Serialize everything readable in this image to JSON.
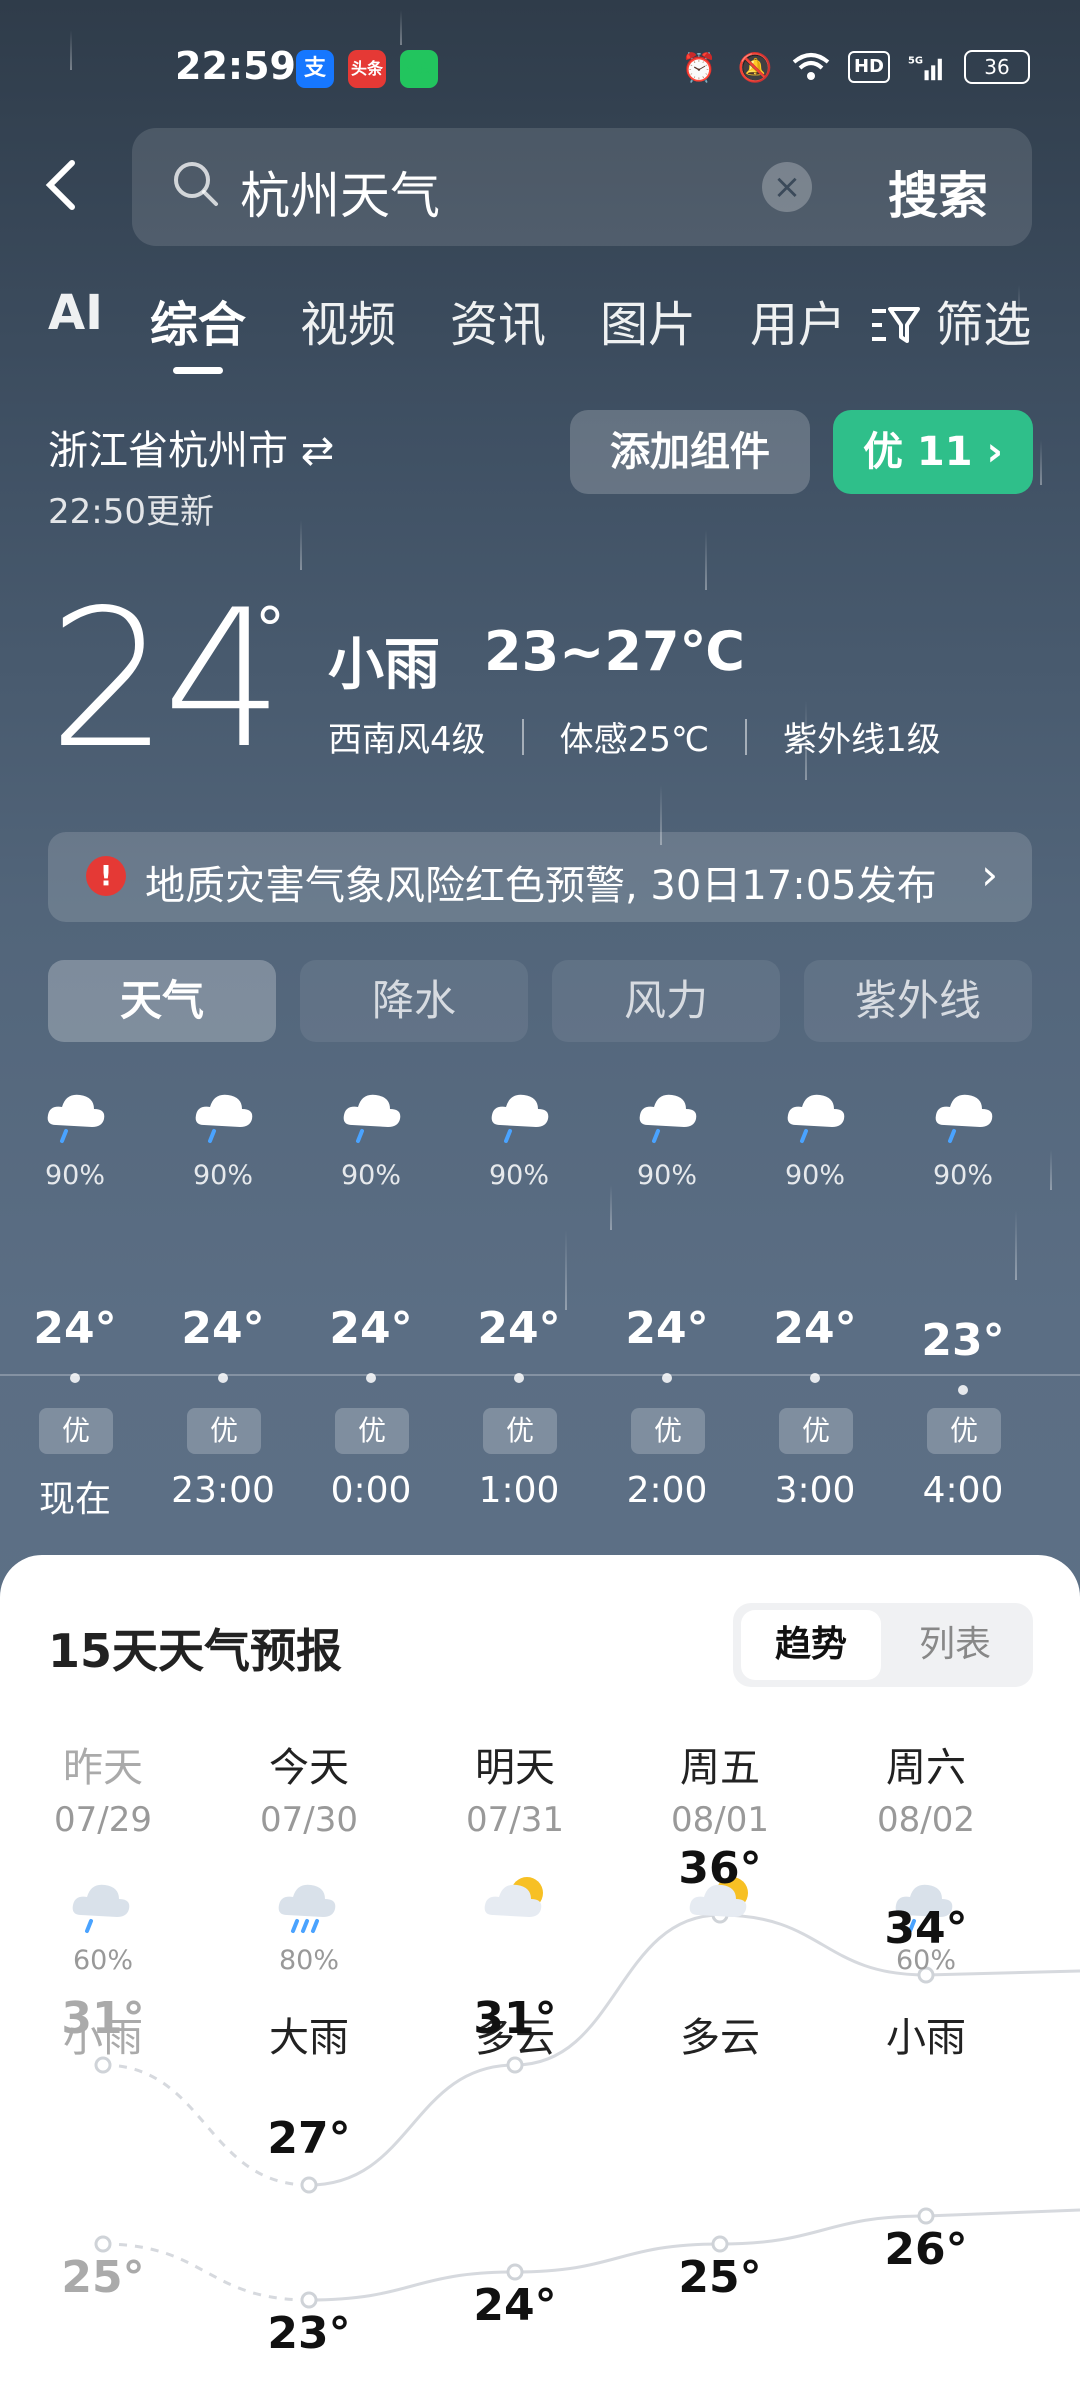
{
  "status": {
    "time": "22:59",
    "apps": [
      "支",
      "头条",
      "信息"
    ],
    "network": "5G",
    "hd": "HD",
    "battery": "36"
  },
  "search": {
    "query": "杭州天气",
    "clear_icon": "×",
    "action": "搜索"
  },
  "tabs": [
    {
      "label": "AI"
    },
    {
      "label": "综合"
    },
    {
      "label": "视频"
    },
    {
      "label": "资讯"
    },
    {
      "label": "图片"
    },
    {
      "label": "用户"
    },
    {
      "label": "筛选"
    }
  ],
  "location": {
    "name": "浙江省杭州市",
    "updated": "22:50更新"
  },
  "actions": {
    "add_widget": "添加组件",
    "aqi": "优 11"
  },
  "current": {
    "temp": "24",
    "deg": "°",
    "condition": "小雨",
    "range": "23~27℃",
    "wind": "西南风4级",
    "feels": "体感25℃",
    "uv": "紫外线1级"
  },
  "alert": {
    "text": "地质灾害气象风险红色预警, 30日17:05发布"
  },
  "segments": [
    {
      "label": "天气"
    },
    {
      "label": "降水"
    },
    {
      "label": "风力"
    },
    {
      "label": "紫外线"
    }
  ],
  "hourly": [
    {
      "time": "现在",
      "temp": "24°",
      "pop": "90%",
      "aqi": "优"
    },
    {
      "time": "23:00",
      "temp": "24°",
      "pop": "90%",
      "aqi": "优"
    },
    {
      "time": "0:00",
      "temp": "24°",
      "pop": "90%",
      "aqi": "优"
    },
    {
      "time": "1:00",
      "temp": "24°",
      "pop": "90%",
      "aqi": "优"
    },
    {
      "time": "2:00",
      "temp": "24°",
      "pop": "90%",
      "aqi": "优"
    },
    {
      "time": "3:00",
      "temp": "24°",
      "pop": "90%",
      "aqi": "优"
    },
    {
      "time": "4:00",
      "temp": "23°",
      "pop": "90%",
      "aqi": "优"
    }
  ],
  "forecast": {
    "title": "15天天气预报",
    "view_trend": "趋势",
    "view_list": "列表",
    "days": [
      {
        "name": "昨天",
        "date": "07/29",
        "pop": "60%",
        "cond": "小雨",
        "icon": "rain-cloud-icon",
        "high": "31°",
        "low": "25°"
      },
      {
        "name": "今天",
        "date": "07/30",
        "pop": "80%",
        "cond": "大雨",
        "icon": "heavy-rain-icon",
        "high": "27°",
        "low": "23°"
      },
      {
        "name": "明天",
        "date": "07/31",
        "pop": "",
        "cond": "多云",
        "icon": "partly-cloudy-icon",
        "high": "31°",
        "low": "24°"
      },
      {
        "name": "周五",
        "date": "08/01",
        "pop": "",
        "cond": "多云",
        "icon": "partly-cloudy-icon",
        "high": "36°",
        "low": "25°"
      },
      {
        "name": "周六",
        "date": "08/02",
        "pop": "60%",
        "cond": "小雨",
        "icon": "rain-cloud-icon",
        "high": "34°",
        "low": "26°"
      }
    ]
  },
  "colors": {
    "accent_green": "#2fbf8a",
    "alert_red": "#e53935"
  }
}
